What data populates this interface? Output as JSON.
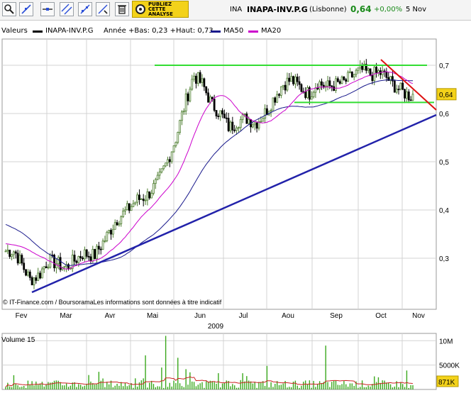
{
  "header": {
    "short_code": "INA",
    "name": "INAPA-INV.P.G",
    "market": "(Lisbonne)",
    "price": "0,64",
    "change": "+0,00%",
    "date": "5 Nov"
  },
  "toolbar": {
    "publish_lines": [
      "PUBLIEZ",
      "CETTE",
      "ANALYSE"
    ],
    "buttons": [
      "zoom-tool",
      "trendline-tool",
      "horizontal-line-tool",
      "parallel-lines-tool",
      "fibonacci-tool",
      "eraser-tool",
      "delete-tool"
    ]
  },
  "legend": {
    "label": "Valeurs",
    "series_name": "INAPA-INV.P.G",
    "range_info": "Année +Bas: 0,23 +Haut: 0,73",
    "ma50": "MA50",
    "ma20": "MA20"
  },
  "colors": {
    "candle_up": "#4c7d2e",
    "candle_down": "#000000",
    "ma50": "#1a1a8c",
    "ma20": "#cc00cc",
    "trend_support": "#2222aa",
    "resistance_green": "#33dd33",
    "trend_down_red": "#dd1111",
    "volume_bar": "#3aa81c",
    "volume_ma": "#cc2222"
  },
  "chart_data": [
    {
      "type": "candlestick",
      "title": "INAPA-INV.P.G",
      "ylim": [
        0.23,
        0.75
      ],
      "yticks": [
        "0,7",
        "0,6",
        "0,5",
        "0,4",
        "0,3"
      ],
      "ytick_values": [
        0.7,
        0.6,
        0.5,
        0.4,
        0.3
      ],
      "last_price_label": "0,64",
      "months": [
        "Fev",
        "Mar",
        "Avr",
        "Mai",
        "Jun",
        "Jul",
        "Aou",
        "Sep",
        "Oct",
        "Nov"
      ],
      "year_label": "2009",
      "copyright": "© IT-Finance.com / BoursoramaLes informations sont données à titre indicatif",
      "approx_closes": [
        {
          "month": "Fev",
          "value": 0.31
        },
        {
          "month": "Mar",
          "value": 0.29
        },
        {
          "month": "Avr",
          "value": 0.33
        },
        {
          "month": "Mai",
          "value": 0.43
        },
        {
          "month": "Jun",
          "value": 0.64
        },
        {
          "month": "Jul",
          "value": 0.58
        },
        {
          "month": "Aou",
          "value": 0.67
        },
        {
          "month": "Sep",
          "value": 0.67
        },
        {
          "month": "Oct",
          "value": 0.68
        },
        {
          "month": "Nov",
          "value": 0.64
        }
      ],
      "lines": {
        "resistance_high": 0.7,
        "resistance_low": 0.623
      }
    },
    {
      "type": "bar",
      "title": "Volume 15",
      "yticks": [
        "10M",
        "5000K"
      ],
      "ytick_values": [
        10000000,
        5000000
      ],
      "ylim": [
        0,
        11500000
      ],
      "last_volume_label": "871K"
    }
  ]
}
